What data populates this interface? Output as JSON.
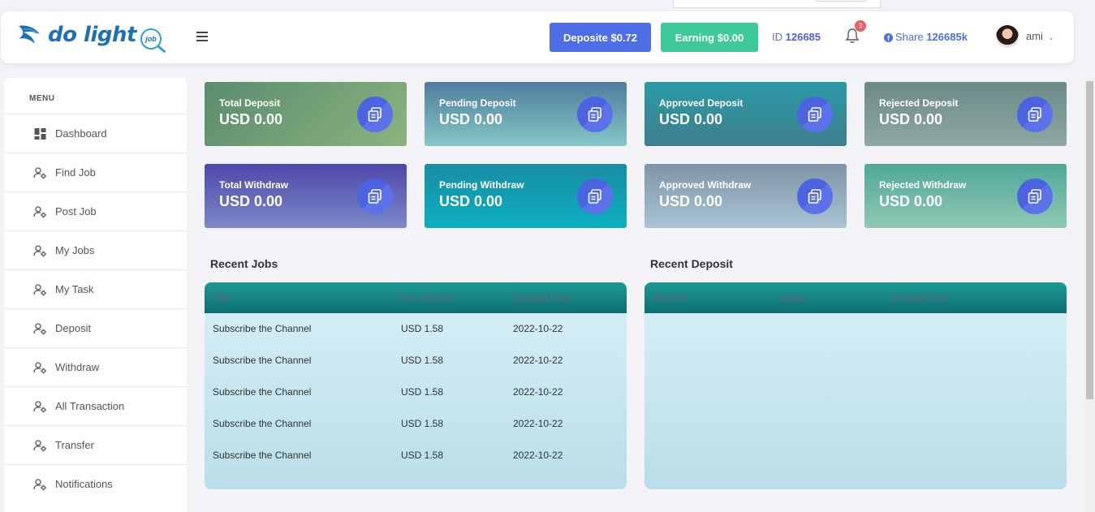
{
  "header": {
    "logo_text": "do light",
    "logo_badge": "job",
    "deposit_button": "Deposite $0.72",
    "earning_button": "Earning $0.00",
    "id_label": "ID",
    "id_value": "126685",
    "notification_count": "3",
    "share_label": "Share",
    "share_value": "126685k",
    "user_name": "ami"
  },
  "sidebar": {
    "menu_title": "MENU",
    "items": [
      {
        "label": "Dashboard",
        "icon": "dashboard-icon"
      },
      {
        "label": "Find Job",
        "icon": "user-gear-icon"
      },
      {
        "label": "Post Job",
        "icon": "user-gear-icon"
      },
      {
        "label": "My Jobs",
        "icon": "user-gear-icon"
      },
      {
        "label": "My Task",
        "icon": "user-gear-icon"
      },
      {
        "label": "Deposit",
        "icon": "user-gear-icon"
      },
      {
        "label": "Withdraw",
        "icon": "user-gear-icon"
      },
      {
        "label": "All Transaction",
        "icon": "user-gear-icon"
      },
      {
        "label": "Transfer",
        "icon": "user-gear-icon"
      },
      {
        "label": "Notifications",
        "icon": "user-gear-icon"
      }
    ]
  },
  "stats": [
    {
      "title": "Total Deposit",
      "value": "USD 0.00"
    },
    {
      "title": "Pending Deposit",
      "value": "USD 0.00"
    },
    {
      "title": "Approved Deposit",
      "value": "USD 0.00"
    },
    {
      "title": "Rejected Deposit",
      "value": "USD 0.00"
    },
    {
      "title": "Total Withdraw",
      "value": "USD 0.00"
    },
    {
      "title": "Pending Withdraw",
      "value": "USD 0.00"
    },
    {
      "title": "Approved Withdraw",
      "value": "USD 0.00"
    },
    {
      "title": "Rejected Withdraw",
      "value": "USD 0.00"
    }
  ],
  "recent_jobs": {
    "title": "Recent Jobs",
    "columns": [
      "Title",
      "Est. Amount",
      "Created Date"
    ],
    "rows": [
      [
        "Subscribe the Channel",
        "USD 1.58",
        "2022-10-22"
      ],
      [
        "Subscribe the Channel",
        "USD 1.58",
        "2022-10-22"
      ],
      [
        "Subscribe the Channel",
        "USD 1.58",
        "2022-10-22"
      ],
      [
        "Subscribe the Channel",
        "USD 1.58",
        "2022-10-22"
      ],
      [
        "Subscribe the Channel",
        "USD 1.58",
        "2022-10-22"
      ]
    ]
  },
  "recent_deposit": {
    "title": "Recent Deposit",
    "columns": [
      "Amount",
      "Status",
      "Created Date"
    ],
    "rows": []
  }
}
